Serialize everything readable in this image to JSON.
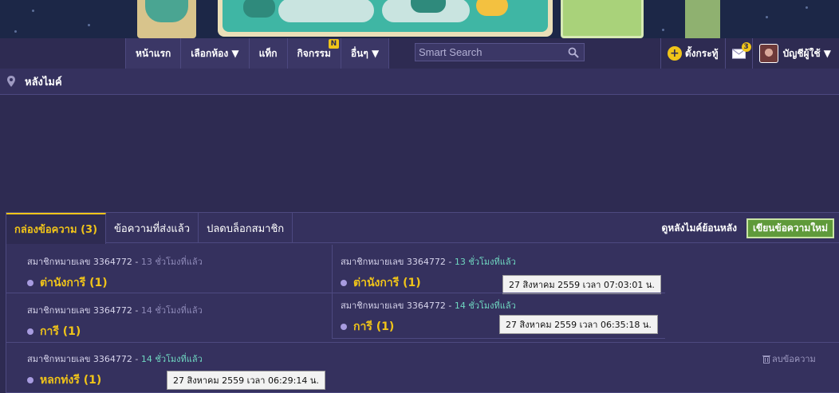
{
  "nav": {
    "items": [
      {
        "label": "หน้าแรก",
        "name": "nav-home"
      },
      {
        "label": "เลือกห้อง ▼",
        "name": "nav-rooms"
      },
      {
        "label": "แท็ก",
        "name": "nav-tags"
      },
      {
        "label": "กิจกรรม",
        "name": "nav-activities",
        "badge": "N"
      },
      {
        "label": "อื่นๆ ▼",
        "name": "nav-more"
      }
    ],
    "search_placeholder": "Smart Search",
    "create_topic": "ตั้งกระทู้",
    "mail_count": "3",
    "account": "บัญชีผู้ใช้ ▼"
  },
  "breadcrumb": "หลังไมค์",
  "tabs": [
    {
      "label": "กล่องข้อความ (3)",
      "active": true
    },
    {
      "label": "ข้อความที่ส่งแล้ว",
      "active": false
    },
    {
      "label": "ปลดบล็อกสมาชิก",
      "active": false
    }
  ],
  "tab_actions": {
    "history": "ดูหลังไมค์ย้อนหลัง",
    "new_message": "เขียนข้อความใหม่"
  },
  "messages_left": [
    {
      "sender": "สมาชิกหมายเลข 3364772",
      "sep": " - ",
      "ago": "13 ชั่วโมงที่แล้ว",
      "subject": "ต่านังการี (1)"
    },
    {
      "sender": "สมาชิกหมายเลข 3364772",
      "sep": " - ",
      "ago": "14 ชั่วโมงที่แล้ว",
      "subject": "การี (1)"
    },
    {
      "sender": "สมาชิกหมายเลข 3364772",
      "sep": " - ",
      "ago": "14 ชั่วโมงที่แล้ว",
      "subject": "หลกท่งรี (1)",
      "tooltip": "27 สิงหาคม 2559 เวลา  06:29:14 น."
    }
  ],
  "messages_right": [
    {
      "sender": "สมาชิกหมายเลข 3364772",
      "sep": " - ",
      "ago": "13 ชั่วโมงที่แล้ว",
      "subject": "ต่านังการี (1)",
      "tooltip": "27 สิงหาคม 2559 เวลา  07:03:01 น."
    },
    {
      "sender": "สมาชิกหมายเลข 3364772",
      "sep": " - ",
      "ago": "14 ชั่วโมงที่แล้ว",
      "subject": "การี (1)",
      "tooltip": "27 สิงหาคม 2559 เวลา  06:35:18 น."
    }
  ],
  "delete_label": "ลบข้อความ",
  "colors": {
    "accent": "#f0c419",
    "background": "#2e2b52",
    "button_green": "#5f9a3a"
  }
}
